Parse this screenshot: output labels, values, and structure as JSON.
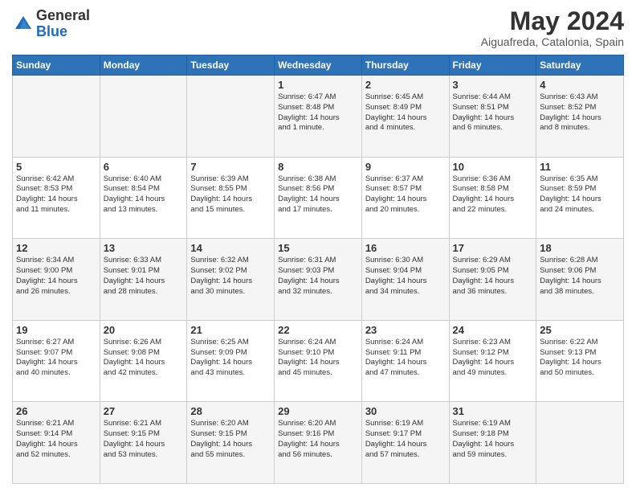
{
  "logo": {
    "general": "General",
    "blue": "Blue"
  },
  "header": {
    "month": "May 2024",
    "location": "Aiguafreda, Catalonia, Spain"
  },
  "days_of_week": [
    "Sunday",
    "Monday",
    "Tuesday",
    "Wednesday",
    "Thursday",
    "Friday",
    "Saturday"
  ],
  "weeks": [
    [
      {
        "day": "",
        "info": ""
      },
      {
        "day": "",
        "info": ""
      },
      {
        "day": "",
        "info": ""
      },
      {
        "day": "1",
        "info": "Sunrise: 6:47 AM\nSunset: 8:48 PM\nDaylight: 14 hours\nand 1 minute."
      },
      {
        "day": "2",
        "info": "Sunrise: 6:45 AM\nSunset: 8:49 PM\nDaylight: 14 hours\nand 4 minutes."
      },
      {
        "day": "3",
        "info": "Sunrise: 6:44 AM\nSunset: 8:51 PM\nDaylight: 14 hours\nand 6 minutes."
      },
      {
        "day": "4",
        "info": "Sunrise: 6:43 AM\nSunset: 8:52 PM\nDaylight: 14 hours\nand 8 minutes."
      }
    ],
    [
      {
        "day": "5",
        "info": "Sunrise: 6:42 AM\nSunset: 8:53 PM\nDaylight: 14 hours\nand 11 minutes."
      },
      {
        "day": "6",
        "info": "Sunrise: 6:40 AM\nSunset: 8:54 PM\nDaylight: 14 hours\nand 13 minutes."
      },
      {
        "day": "7",
        "info": "Sunrise: 6:39 AM\nSunset: 8:55 PM\nDaylight: 14 hours\nand 15 minutes."
      },
      {
        "day": "8",
        "info": "Sunrise: 6:38 AM\nSunset: 8:56 PM\nDaylight: 14 hours\nand 17 minutes."
      },
      {
        "day": "9",
        "info": "Sunrise: 6:37 AM\nSunset: 8:57 PM\nDaylight: 14 hours\nand 20 minutes."
      },
      {
        "day": "10",
        "info": "Sunrise: 6:36 AM\nSunset: 8:58 PM\nDaylight: 14 hours\nand 22 minutes."
      },
      {
        "day": "11",
        "info": "Sunrise: 6:35 AM\nSunset: 8:59 PM\nDaylight: 14 hours\nand 24 minutes."
      }
    ],
    [
      {
        "day": "12",
        "info": "Sunrise: 6:34 AM\nSunset: 9:00 PM\nDaylight: 14 hours\nand 26 minutes."
      },
      {
        "day": "13",
        "info": "Sunrise: 6:33 AM\nSunset: 9:01 PM\nDaylight: 14 hours\nand 28 minutes."
      },
      {
        "day": "14",
        "info": "Sunrise: 6:32 AM\nSunset: 9:02 PM\nDaylight: 14 hours\nand 30 minutes."
      },
      {
        "day": "15",
        "info": "Sunrise: 6:31 AM\nSunset: 9:03 PM\nDaylight: 14 hours\nand 32 minutes."
      },
      {
        "day": "16",
        "info": "Sunrise: 6:30 AM\nSunset: 9:04 PM\nDaylight: 14 hours\nand 34 minutes."
      },
      {
        "day": "17",
        "info": "Sunrise: 6:29 AM\nSunset: 9:05 PM\nDaylight: 14 hours\nand 36 minutes."
      },
      {
        "day": "18",
        "info": "Sunrise: 6:28 AM\nSunset: 9:06 PM\nDaylight: 14 hours\nand 38 minutes."
      }
    ],
    [
      {
        "day": "19",
        "info": "Sunrise: 6:27 AM\nSunset: 9:07 PM\nDaylight: 14 hours\nand 40 minutes."
      },
      {
        "day": "20",
        "info": "Sunrise: 6:26 AM\nSunset: 9:08 PM\nDaylight: 14 hours\nand 42 minutes."
      },
      {
        "day": "21",
        "info": "Sunrise: 6:25 AM\nSunset: 9:09 PM\nDaylight: 14 hours\nand 43 minutes."
      },
      {
        "day": "22",
        "info": "Sunrise: 6:24 AM\nSunset: 9:10 PM\nDaylight: 14 hours\nand 45 minutes."
      },
      {
        "day": "23",
        "info": "Sunrise: 6:24 AM\nSunset: 9:11 PM\nDaylight: 14 hours\nand 47 minutes."
      },
      {
        "day": "24",
        "info": "Sunrise: 6:23 AM\nSunset: 9:12 PM\nDaylight: 14 hours\nand 49 minutes."
      },
      {
        "day": "25",
        "info": "Sunrise: 6:22 AM\nSunset: 9:13 PM\nDaylight: 14 hours\nand 50 minutes."
      }
    ],
    [
      {
        "day": "26",
        "info": "Sunrise: 6:21 AM\nSunset: 9:14 PM\nDaylight: 14 hours\nand 52 minutes."
      },
      {
        "day": "27",
        "info": "Sunrise: 6:21 AM\nSunset: 9:15 PM\nDaylight: 14 hours\nand 53 minutes."
      },
      {
        "day": "28",
        "info": "Sunrise: 6:20 AM\nSunset: 9:15 PM\nDaylight: 14 hours\nand 55 minutes."
      },
      {
        "day": "29",
        "info": "Sunrise: 6:20 AM\nSunset: 9:16 PM\nDaylight: 14 hours\nand 56 minutes."
      },
      {
        "day": "30",
        "info": "Sunrise: 6:19 AM\nSunset: 9:17 PM\nDaylight: 14 hours\nand 57 minutes."
      },
      {
        "day": "31",
        "info": "Sunrise: 6:19 AM\nSunset: 9:18 PM\nDaylight: 14 hours\nand 59 minutes."
      },
      {
        "day": "",
        "info": ""
      }
    ]
  ]
}
